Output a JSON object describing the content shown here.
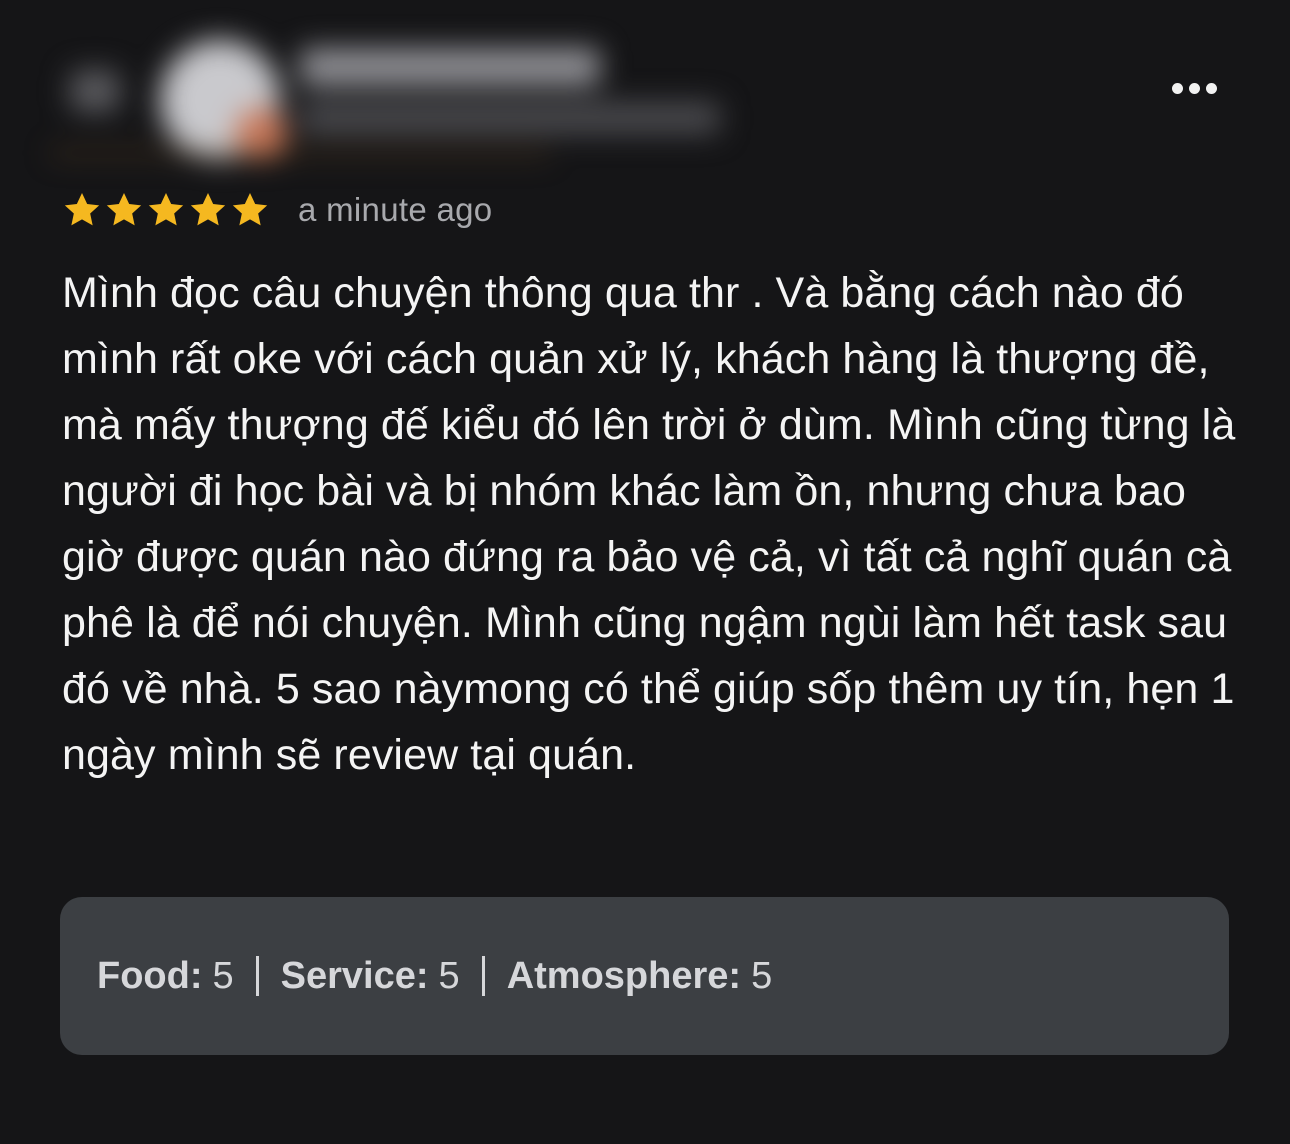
{
  "review": {
    "rating": 5,
    "max_rating": 5,
    "time": "a minute ago",
    "text": "Mình đọc câu chuyện thông qua thr . Và bằng cách nào đó mình rất oke với cách quản xử lý, khách hàng là thượng đề, mà mấy thượng đế kiểu đó lên trời ở dùm. Mình cũng từng là người đi học bài và bị nhóm khác làm ồn, nhưng chưa bao giờ được quán nào đứng ra bảo vệ cả, vì tất cả nghĩ quán cà phê là để nói chuyện. Mình cũng ngậm ngùi làm hết task sau đó về nhà. 5 sao nàymong có thể giúp sốp thêm uy tín, hẹn 1 ngày mình sẽ review tại quán."
  },
  "aspects": [
    {
      "label": "Food:",
      "value": "5"
    },
    {
      "label": "Service:",
      "value": "5"
    },
    {
      "label": "Atmosphere:",
      "value": "5"
    }
  ],
  "icons": {
    "more": "more-horizontal-icon",
    "star": "star-icon"
  },
  "colors": {
    "background": "#151517",
    "star": "#f5b820",
    "aspects_background": "#3c3f43"
  }
}
